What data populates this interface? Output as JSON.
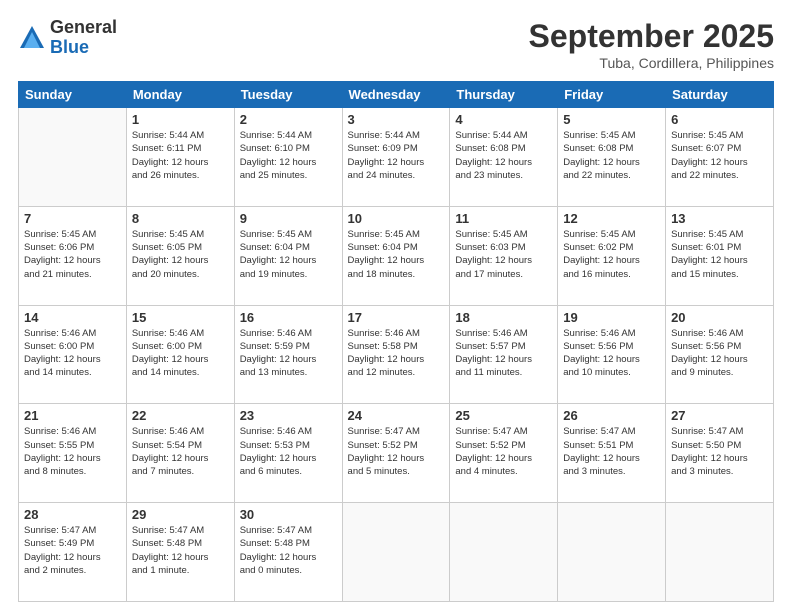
{
  "logo": {
    "general": "General",
    "blue": "Blue"
  },
  "title": "September 2025",
  "location": "Tuba, Cordillera, Philippines",
  "days_header": [
    "Sunday",
    "Monday",
    "Tuesday",
    "Wednesday",
    "Thursday",
    "Friday",
    "Saturday"
  ],
  "weeks": [
    [
      {
        "day": "",
        "info": ""
      },
      {
        "day": "1",
        "info": "Sunrise: 5:44 AM\nSunset: 6:11 PM\nDaylight: 12 hours\nand 26 minutes."
      },
      {
        "day": "2",
        "info": "Sunrise: 5:44 AM\nSunset: 6:10 PM\nDaylight: 12 hours\nand 25 minutes."
      },
      {
        "day": "3",
        "info": "Sunrise: 5:44 AM\nSunset: 6:09 PM\nDaylight: 12 hours\nand 24 minutes."
      },
      {
        "day": "4",
        "info": "Sunrise: 5:44 AM\nSunset: 6:08 PM\nDaylight: 12 hours\nand 23 minutes."
      },
      {
        "day": "5",
        "info": "Sunrise: 5:45 AM\nSunset: 6:08 PM\nDaylight: 12 hours\nand 22 minutes."
      },
      {
        "day": "6",
        "info": "Sunrise: 5:45 AM\nSunset: 6:07 PM\nDaylight: 12 hours\nand 22 minutes."
      }
    ],
    [
      {
        "day": "7",
        "info": "Sunrise: 5:45 AM\nSunset: 6:06 PM\nDaylight: 12 hours\nand 21 minutes."
      },
      {
        "day": "8",
        "info": "Sunrise: 5:45 AM\nSunset: 6:05 PM\nDaylight: 12 hours\nand 20 minutes."
      },
      {
        "day": "9",
        "info": "Sunrise: 5:45 AM\nSunset: 6:04 PM\nDaylight: 12 hours\nand 19 minutes."
      },
      {
        "day": "10",
        "info": "Sunrise: 5:45 AM\nSunset: 6:04 PM\nDaylight: 12 hours\nand 18 minutes."
      },
      {
        "day": "11",
        "info": "Sunrise: 5:45 AM\nSunset: 6:03 PM\nDaylight: 12 hours\nand 17 minutes."
      },
      {
        "day": "12",
        "info": "Sunrise: 5:45 AM\nSunset: 6:02 PM\nDaylight: 12 hours\nand 16 minutes."
      },
      {
        "day": "13",
        "info": "Sunrise: 5:45 AM\nSunset: 6:01 PM\nDaylight: 12 hours\nand 15 minutes."
      }
    ],
    [
      {
        "day": "14",
        "info": "Sunrise: 5:46 AM\nSunset: 6:00 PM\nDaylight: 12 hours\nand 14 minutes."
      },
      {
        "day": "15",
        "info": "Sunrise: 5:46 AM\nSunset: 6:00 PM\nDaylight: 12 hours\nand 14 minutes."
      },
      {
        "day": "16",
        "info": "Sunrise: 5:46 AM\nSunset: 5:59 PM\nDaylight: 12 hours\nand 13 minutes."
      },
      {
        "day": "17",
        "info": "Sunrise: 5:46 AM\nSunset: 5:58 PM\nDaylight: 12 hours\nand 12 minutes."
      },
      {
        "day": "18",
        "info": "Sunrise: 5:46 AM\nSunset: 5:57 PM\nDaylight: 12 hours\nand 11 minutes."
      },
      {
        "day": "19",
        "info": "Sunrise: 5:46 AM\nSunset: 5:56 PM\nDaylight: 12 hours\nand 10 minutes."
      },
      {
        "day": "20",
        "info": "Sunrise: 5:46 AM\nSunset: 5:56 PM\nDaylight: 12 hours\nand 9 minutes."
      }
    ],
    [
      {
        "day": "21",
        "info": "Sunrise: 5:46 AM\nSunset: 5:55 PM\nDaylight: 12 hours\nand 8 minutes."
      },
      {
        "day": "22",
        "info": "Sunrise: 5:46 AM\nSunset: 5:54 PM\nDaylight: 12 hours\nand 7 minutes."
      },
      {
        "day": "23",
        "info": "Sunrise: 5:46 AM\nSunset: 5:53 PM\nDaylight: 12 hours\nand 6 minutes."
      },
      {
        "day": "24",
        "info": "Sunrise: 5:47 AM\nSunset: 5:52 PM\nDaylight: 12 hours\nand 5 minutes."
      },
      {
        "day": "25",
        "info": "Sunrise: 5:47 AM\nSunset: 5:52 PM\nDaylight: 12 hours\nand 4 minutes."
      },
      {
        "day": "26",
        "info": "Sunrise: 5:47 AM\nSunset: 5:51 PM\nDaylight: 12 hours\nand 3 minutes."
      },
      {
        "day": "27",
        "info": "Sunrise: 5:47 AM\nSunset: 5:50 PM\nDaylight: 12 hours\nand 3 minutes."
      }
    ],
    [
      {
        "day": "28",
        "info": "Sunrise: 5:47 AM\nSunset: 5:49 PM\nDaylight: 12 hours\nand 2 minutes."
      },
      {
        "day": "29",
        "info": "Sunrise: 5:47 AM\nSunset: 5:48 PM\nDaylight: 12 hours\nand 1 minute."
      },
      {
        "day": "30",
        "info": "Sunrise: 5:47 AM\nSunset: 5:48 PM\nDaylight: 12 hours\nand 0 minutes."
      },
      {
        "day": "",
        "info": ""
      },
      {
        "day": "",
        "info": ""
      },
      {
        "day": "",
        "info": ""
      },
      {
        "day": "",
        "info": ""
      }
    ]
  ]
}
